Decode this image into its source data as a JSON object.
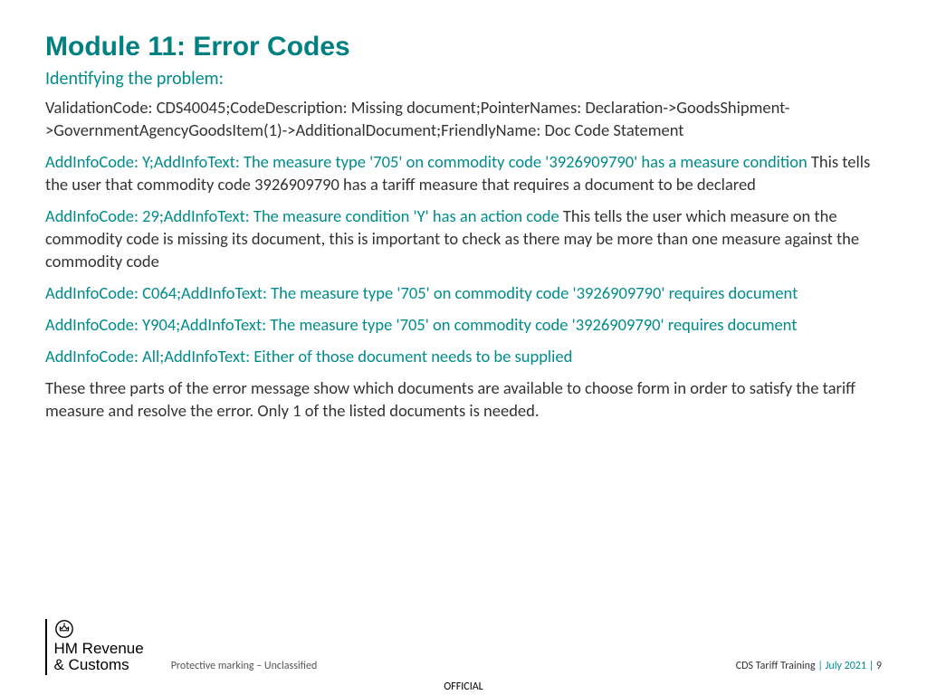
{
  "title": "Module 11: Error Codes",
  "subtitle": "Identifying the problem:",
  "p1": "ValidationCode: CDS40045;CodeDescription: Missing document;PointerNames: Declaration->GoodsShipment->GovernmentAgencyGoodsItem(1)->AdditionalDocument;FriendlyName: Doc Code Statement",
  "p2_teal": "AddInfoCode: Y;AddInfoText: The measure type '705' on commodity code '3926909790' has a measure condition",
  "p2_rest": " This tells the user that commodity code 3926909790 has a tariff measure that requires a document to be declared",
  "p3_teal": "AddInfoCode: 29;AddInfoText: The measure condition 'Y' has an action code",
  "p3_rest": " This tells the user which measure on the commodity code is missing its document, this is important to check as there may be more than one measure against the commodity code",
  "p4_teal": "AddInfoCode: C064;AddInfoText: The measure type '705' on commodity code '3926909790' requires document",
  "p5_teal": "AddInfoCode: Y904;AddInfoText: The measure type '705' on commodity code '3926909790' requires document",
  "p6_teal": "AddInfoCode: All;AddInfoText: Either of those document needs to be supplied",
  "p7": "These three parts of the error message show which documents are available to choose form in order to satisfy the tariff measure and resolve the error.  Only 1 of the listed documents is needed.",
  "logo_line1": "HM Revenue",
  "logo_line2": "& Customs",
  "protective": "Protective marking – Unclassified",
  "foot_left": "CDS Tariff Training  ",
  "foot_date": "| July 2021 |",
  "foot_page": "  9",
  "official": "OFFICIAL"
}
